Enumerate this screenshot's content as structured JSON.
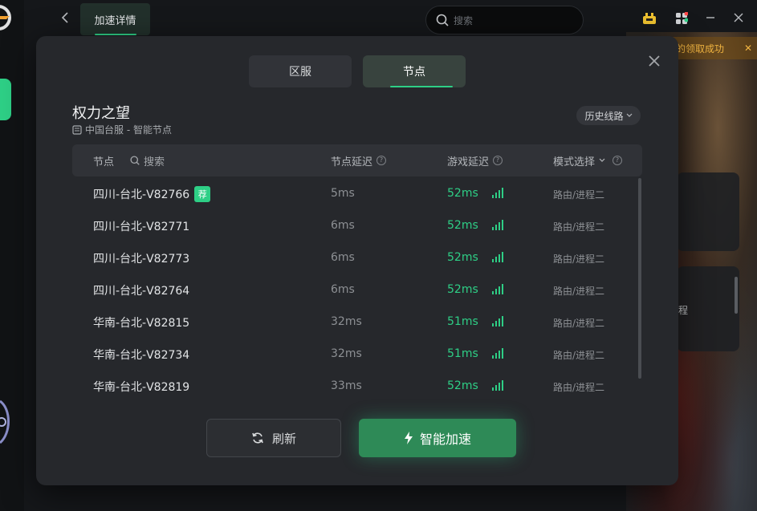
{
  "topbar": {
    "tab_label": "加速详情",
    "search_placeholder": "搜索"
  },
  "toast": {
    "text": "的领取成功"
  },
  "background": {
    "card_text": "程"
  },
  "modal": {
    "tabs": [
      {
        "label": "区服",
        "active": false
      },
      {
        "label": "节点",
        "active": true
      }
    ],
    "game_title": "权力之望",
    "game_subtitle": "中国台服 - 智能节点",
    "history_label": "历史线路",
    "table": {
      "col_node": "节点",
      "col_search": "搜索",
      "col_node_latency": "节点延迟",
      "col_game_latency": "游戏延迟",
      "col_mode": "模式选择",
      "rows": [
        {
          "name": "四川-台北-V82766",
          "badge": "荐",
          "node_latency": "5ms",
          "game_latency": "52ms",
          "mode": "路由/进程二"
        },
        {
          "name": "四川-台北-V82771",
          "badge": "",
          "node_latency": "6ms",
          "game_latency": "52ms",
          "mode": "路由/进程二"
        },
        {
          "name": "四川-台北-V82773",
          "badge": "",
          "node_latency": "6ms",
          "game_latency": "52ms",
          "mode": "路由/进程二"
        },
        {
          "name": "四川-台北-V82764",
          "badge": "",
          "node_latency": "6ms",
          "game_latency": "52ms",
          "mode": "路由/进程二"
        },
        {
          "name": "华南-台北-V82815",
          "badge": "",
          "node_latency": "32ms",
          "game_latency": "51ms",
          "mode": "路由/进程二"
        },
        {
          "name": "华南-台北-V82734",
          "badge": "",
          "node_latency": "32ms",
          "game_latency": "51ms",
          "mode": "路由/进程二"
        },
        {
          "name": "华南-台北-V82819",
          "badge": "",
          "node_latency": "33ms",
          "game_latency": "52ms",
          "mode": "路由/进程二"
        }
      ]
    },
    "refresh_label": "刷新",
    "accelerate_label": "智能加速"
  },
  "colors": {
    "accent": "#2ecf86",
    "accelerate_button": "#2e8a57",
    "toast_text": "#f0b441",
    "modal_bg": "#26282c"
  },
  "icons": [
    "back-icon",
    "search-icon",
    "gift-icon",
    "apps-icon",
    "minimize-icon",
    "close-icon",
    "server-icon",
    "chevron-down-icon",
    "help-icon",
    "signal-icon",
    "refresh-icon",
    "lightning-icon"
  ]
}
